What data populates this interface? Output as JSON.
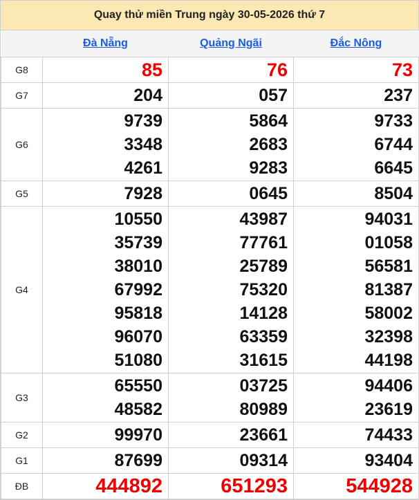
{
  "title": "Quay thử miền Trung ngày 30-05-2026 thứ 7",
  "provinces": [
    "Đà Nẵng",
    "Quảng Ngãi",
    "Đắc Nông"
  ],
  "colors": {
    "header_bg": "#fbe8b2",
    "link": "#1a5ce6",
    "highlight": "#e00000"
  },
  "rows": [
    {
      "label": "G8",
      "cls": "g8",
      "values": [
        [
          "85"
        ],
        [
          "76"
        ],
        [
          "73"
        ]
      ]
    },
    {
      "label": "G7",
      "cls": "",
      "values": [
        [
          "204"
        ],
        [
          "057"
        ],
        [
          "237"
        ]
      ]
    },
    {
      "label": "G6",
      "cls": "",
      "values": [
        [
          "9739",
          "3348",
          "4261"
        ],
        [
          "5864",
          "2683",
          "9283"
        ],
        [
          "9733",
          "6744",
          "6645"
        ]
      ]
    },
    {
      "label": "G5",
      "cls": "",
      "values": [
        [
          "7928"
        ],
        [
          "0645"
        ],
        [
          "8504"
        ]
      ]
    },
    {
      "label": "G4",
      "cls": "",
      "values": [
        [
          "10550",
          "35739",
          "38010",
          "67992",
          "95818",
          "96070",
          "51080"
        ],
        [
          "43987",
          "77761",
          "25789",
          "75320",
          "14128",
          "63359",
          "31615"
        ],
        [
          "94031",
          "01058",
          "56581",
          "81387",
          "58002",
          "32398",
          "44198"
        ]
      ]
    },
    {
      "label": "G3",
      "cls": "",
      "values": [
        [
          "65550",
          "48582"
        ],
        [
          "03725",
          "80989"
        ],
        [
          "94406",
          "23619"
        ]
      ]
    },
    {
      "label": "G2",
      "cls": "",
      "values": [
        [
          "99970"
        ],
        [
          "23661"
        ],
        [
          "74433"
        ]
      ]
    },
    {
      "label": "G1",
      "cls": "",
      "values": [
        [
          "87699"
        ],
        [
          "09314"
        ],
        [
          "93404"
        ]
      ]
    },
    {
      "label": "ĐB",
      "cls": "db",
      "values": [
        [
          "444892"
        ],
        [
          "651293"
        ],
        [
          "544928"
        ]
      ]
    }
  ]
}
